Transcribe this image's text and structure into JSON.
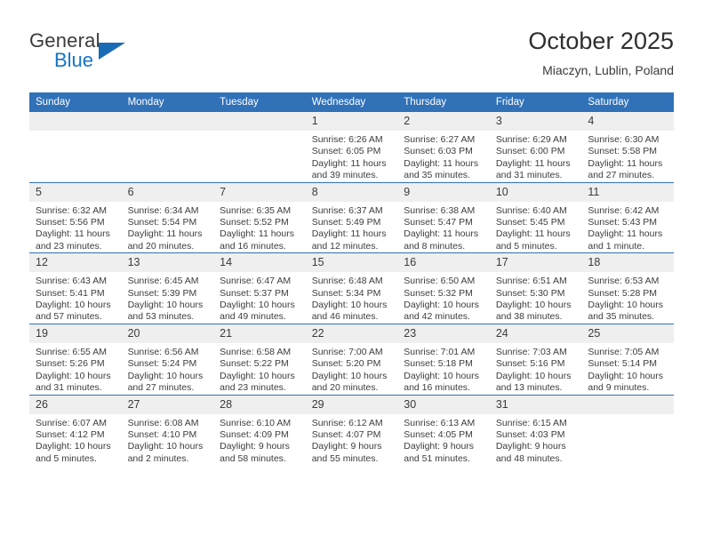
{
  "branding": {
    "name_part1": "General",
    "name_part2": "Blue"
  },
  "header": {
    "title": "October 2025",
    "location": "Miaczyn, Lublin, Poland"
  },
  "calendar": {
    "weekday_headers": [
      "Sunday",
      "Monday",
      "Tuesday",
      "Wednesday",
      "Thursday",
      "Friday",
      "Saturday"
    ],
    "labels": {
      "sunrise": "Sunrise:",
      "sunset": "Sunset:",
      "daylight": "Daylight:"
    },
    "weeks": [
      [
        {
          "day": "",
          "sunrise": "",
          "sunset": "",
          "daylight": ""
        },
        {
          "day": "",
          "sunrise": "",
          "sunset": "",
          "daylight": ""
        },
        {
          "day": "",
          "sunrise": "",
          "sunset": "",
          "daylight": ""
        },
        {
          "day": "1",
          "sunrise": "Sunrise: 6:26 AM",
          "sunset": "Sunset: 6:05 PM",
          "daylight": "Daylight: 11 hours and 39 minutes."
        },
        {
          "day": "2",
          "sunrise": "Sunrise: 6:27 AM",
          "sunset": "Sunset: 6:03 PM",
          "daylight": "Daylight: 11 hours and 35 minutes."
        },
        {
          "day": "3",
          "sunrise": "Sunrise: 6:29 AM",
          "sunset": "Sunset: 6:00 PM",
          "daylight": "Daylight: 11 hours and 31 minutes."
        },
        {
          "day": "4",
          "sunrise": "Sunrise: 6:30 AM",
          "sunset": "Sunset: 5:58 PM",
          "daylight": "Daylight: 11 hours and 27 minutes."
        }
      ],
      [
        {
          "day": "5",
          "sunrise": "Sunrise: 6:32 AM",
          "sunset": "Sunset: 5:56 PM",
          "daylight": "Daylight: 11 hours and 23 minutes."
        },
        {
          "day": "6",
          "sunrise": "Sunrise: 6:34 AM",
          "sunset": "Sunset: 5:54 PM",
          "daylight": "Daylight: 11 hours and 20 minutes."
        },
        {
          "day": "7",
          "sunrise": "Sunrise: 6:35 AM",
          "sunset": "Sunset: 5:52 PM",
          "daylight": "Daylight: 11 hours and 16 minutes."
        },
        {
          "day": "8",
          "sunrise": "Sunrise: 6:37 AM",
          "sunset": "Sunset: 5:49 PM",
          "daylight": "Daylight: 11 hours and 12 minutes."
        },
        {
          "day": "9",
          "sunrise": "Sunrise: 6:38 AM",
          "sunset": "Sunset: 5:47 PM",
          "daylight": "Daylight: 11 hours and 8 minutes."
        },
        {
          "day": "10",
          "sunrise": "Sunrise: 6:40 AM",
          "sunset": "Sunset: 5:45 PM",
          "daylight": "Daylight: 11 hours and 5 minutes."
        },
        {
          "day": "11",
          "sunrise": "Sunrise: 6:42 AM",
          "sunset": "Sunset: 5:43 PM",
          "daylight": "Daylight: 11 hours and 1 minute."
        }
      ],
      [
        {
          "day": "12",
          "sunrise": "Sunrise: 6:43 AM",
          "sunset": "Sunset: 5:41 PM",
          "daylight": "Daylight: 10 hours and 57 minutes."
        },
        {
          "day": "13",
          "sunrise": "Sunrise: 6:45 AM",
          "sunset": "Sunset: 5:39 PM",
          "daylight": "Daylight: 10 hours and 53 minutes."
        },
        {
          "day": "14",
          "sunrise": "Sunrise: 6:47 AM",
          "sunset": "Sunset: 5:37 PM",
          "daylight": "Daylight: 10 hours and 49 minutes."
        },
        {
          "day": "15",
          "sunrise": "Sunrise: 6:48 AM",
          "sunset": "Sunset: 5:34 PM",
          "daylight": "Daylight: 10 hours and 46 minutes."
        },
        {
          "day": "16",
          "sunrise": "Sunrise: 6:50 AM",
          "sunset": "Sunset: 5:32 PM",
          "daylight": "Daylight: 10 hours and 42 minutes."
        },
        {
          "day": "17",
          "sunrise": "Sunrise: 6:51 AM",
          "sunset": "Sunset: 5:30 PM",
          "daylight": "Daylight: 10 hours and 38 minutes."
        },
        {
          "day": "18",
          "sunrise": "Sunrise: 6:53 AM",
          "sunset": "Sunset: 5:28 PM",
          "daylight": "Daylight: 10 hours and 35 minutes."
        }
      ],
      [
        {
          "day": "19",
          "sunrise": "Sunrise: 6:55 AM",
          "sunset": "Sunset: 5:26 PM",
          "daylight": "Daylight: 10 hours and 31 minutes."
        },
        {
          "day": "20",
          "sunrise": "Sunrise: 6:56 AM",
          "sunset": "Sunset: 5:24 PM",
          "daylight": "Daylight: 10 hours and 27 minutes."
        },
        {
          "day": "21",
          "sunrise": "Sunrise: 6:58 AM",
          "sunset": "Sunset: 5:22 PM",
          "daylight": "Daylight: 10 hours and 23 minutes."
        },
        {
          "day": "22",
          "sunrise": "Sunrise: 7:00 AM",
          "sunset": "Sunset: 5:20 PM",
          "daylight": "Daylight: 10 hours and 20 minutes."
        },
        {
          "day": "23",
          "sunrise": "Sunrise: 7:01 AM",
          "sunset": "Sunset: 5:18 PM",
          "daylight": "Daylight: 10 hours and 16 minutes."
        },
        {
          "day": "24",
          "sunrise": "Sunrise: 7:03 AM",
          "sunset": "Sunset: 5:16 PM",
          "daylight": "Daylight: 10 hours and 13 minutes."
        },
        {
          "day": "25",
          "sunrise": "Sunrise: 7:05 AM",
          "sunset": "Sunset: 5:14 PM",
          "daylight": "Daylight: 10 hours and 9 minutes."
        }
      ],
      [
        {
          "day": "26",
          "sunrise": "Sunrise: 6:07 AM",
          "sunset": "Sunset: 4:12 PM",
          "daylight": "Daylight: 10 hours and 5 minutes."
        },
        {
          "day": "27",
          "sunrise": "Sunrise: 6:08 AM",
          "sunset": "Sunset: 4:10 PM",
          "daylight": "Daylight: 10 hours and 2 minutes."
        },
        {
          "day": "28",
          "sunrise": "Sunrise: 6:10 AM",
          "sunset": "Sunset: 4:09 PM",
          "daylight": "Daylight: 9 hours and 58 minutes."
        },
        {
          "day": "29",
          "sunrise": "Sunrise: 6:12 AM",
          "sunset": "Sunset: 4:07 PM",
          "daylight": "Daylight: 9 hours and 55 minutes."
        },
        {
          "day": "30",
          "sunrise": "Sunrise: 6:13 AM",
          "sunset": "Sunset: 4:05 PM",
          "daylight": "Daylight: 9 hours and 51 minutes."
        },
        {
          "day": "31",
          "sunrise": "Sunrise: 6:15 AM",
          "sunset": "Sunset: 4:03 PM",
          "daylight": "Daylight: 9 hours and 48 minutes."
        },
        {
          "day": "",
          "sunrise": "",
          "sunset": "",
          "daylight": ""
        }
      ]
    ]
  },
  "colors": {
    "header_blue": "#3071b8",
    "logo_blue": "#1573c6",
    "daynum_band": "#efefef"
  }
}
